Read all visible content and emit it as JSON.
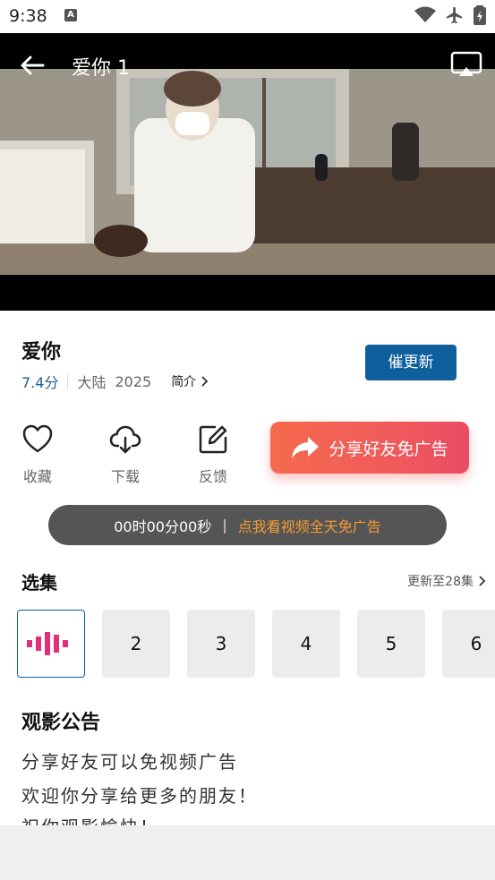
{
  "status_bar": {
    "time": "9:38",
    "badge": "A"
  },
  "player": {
    "title": "爱你 1"
  },
  "show": {
    "title": "爱你",
    "score": "7.4分",
    "region": "大陆",
    "year": "2025",
    "intro_label": "简介",
    "update_button": "催更新"
  },
  "actions": {
    "favorite": "收藏",
    "download": "下载",
    "feedback": "反馈",
    "share": "分享好友免广告"
  },
  "timer": {
    "time": "00时00分00秒",
    "divider": "|",
    "cta": "点我看视频全天免广告"
  },
  "episodes": {
    "title": "选集",
    "more": "更新至28集",
    "items": [
      "2",
      "3",
      "4",
      "5",
      "6"
    ]
  },
  "notice": {
    "title": "观影公告",
    "lines": [
      "分享好友可以免视频广告",
      "欢迎你分享给更多的朋友！",
      "祝你观影愉快！"
    ]
  },
  "colors": {
    "accent": "#0e5f9c",
    "cta": "#f59a34",
    "share_gradient_start": "#f56a4d",
    "share_gradient_end": "#ea4b63",
    "episode_playing": "#e0307a"
  },
  "icons": [
    "arrow-back-icon",
    "cast-icon",
    "heart-icon",
    "cloud-download-icon",
    "edit-icon",
    "share-arrow-icon",
    "chevron-right-icon",
    "wifi-icon",
    "airplane-icon",
    "battery-icon",
    "playing-bars-icon"
  ]
}
